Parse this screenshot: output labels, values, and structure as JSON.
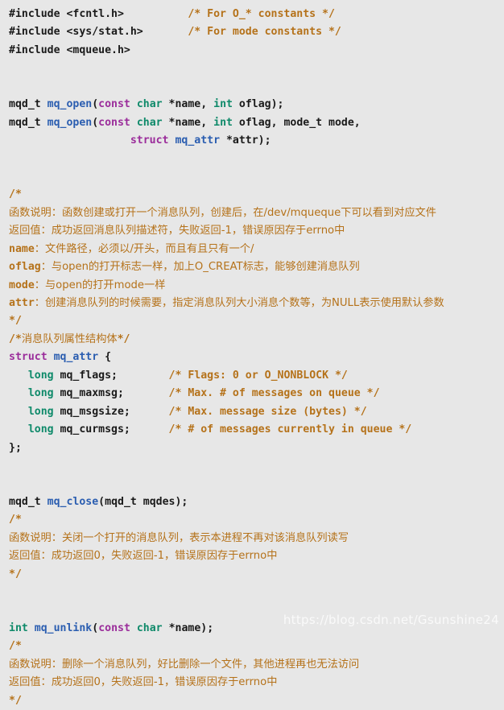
{
  "document": {
    "kind": "source-code-snippet",
    "language": "C",
    "background_color": "#e7e7e7",
    "colors": {
      "plain": "#1a1a1a",
      "comment": "#b5721a",
      "keyword": "#9b2d9b",
      "type": "#0f8a6a",
      "function": "#2a5db0",
      "watermark": "#ffffff"
    }
  },
  "watermark": {
    "text": "https://blog.csdn.net/Gsunshine24"
  },
  "lines": [
    {
      "n": 1,
      "tokens": [
        {
          "t": "plain",
          "v": "#include <fcntl.h>"
        },
        {
          "t": "plain",
          "v": "          "
        },
        {
          "t": "comment",
          "v": "/* For O_* constants */"
        }
      ]
    },
    {
      "n": 2,
      "tokens": [
        {
          "t": "plain",
          "v": "#include <sys/stat.h>"
        },
        {
          "t": "plain",
          "v": "       "
        },
        {
          "t": "comment",
          "v": "/* For mode constants */"
        }
      ]
    },
    {
      "n": 3,
      "tokens": [
        {
          "t": "plain",
          "v": "#include <mqueue.h>"
        }
      ]
    },
    {
      "n": 4,
      "tokens": []
    },
    {
      "n": 5,
      "tokens": []
    },
    {
      "n": 6,
      "tokens": [
        {
          "t": "plain",
          "v": "mqd_t "
        },
        {
          "t": "func",
          "v": "mq_open"
        },
        {
          "t": "punct",
          "v": "("
        },
        {
          "t": "keyword",
          "v": "const"
        },
        {
          "t": "plain",
          "v": " "
        },
        {
          "t": "type",
          "v": "char"
        },
        {
          "t": "plain",
          "v": " *name, "
        },
        {
          "t": "type",
          "v": "int"
        },
        {
          "t": "plain",
          "v": " oflag"
        },
        {
          "t": "punct",
          "v": ");"
        }
      ]
    },
    {
      "n": 7,
      "tokens": [
        {
          "t": "plain",
          "v": "mqd_t "
        },
        {
          "t": "func",
          "v": "mq_open"
        },
        {
          "t": "punct",
          "v": "("
        },
        {
          "t": "keyword",
          "v": "const"
        },
        {
          "t": "plain",
          "v": " "
        },
        {
          "t": "type",
          "v": "char"
        },
        {
          "t": "plain",
          "v": " *name, "
        },
        {
          "t": "type",
          "v": "int"
        },
        {
          "t": "plain",
          "v": " oflag, mode_t mode,"
        }
      ]
    },
    {
      "n": 8,
      "tokens": [
        {
          "t": "plain",
          "v": "                   "
        },
        {
          "t": "keyword",
          "v": "struct"
        },
        {
          "t": "plain",
          "v": " "
        },
        {
          "t": "func",
          "v": "mq_attr"
        },
        {
          "t": "plain",
          "v": " *attr"
        },
        {
          "t": "punct",
          "v": ");"
        }
      ]
    },
    {
      "n": 9,
      "tokens": []
    },
    {
      "n": 10,
      "tokens": []
    },
    {
      "n": 11,
      "tokens": [
        {
          "t": "comment",
          "v": "/*"
        }
      ]
    },
    {
      "n": 12,
      "tokens": [
        {
          "t": "cjk",
          "v": "函数说明："
        },
        {
          "t": "cjk",
          "v": "函数创建或打开一个消息队列，创建后，在/dev/mqueque下可以看到对应文件"
        }
      ]
    },
    {
      "n": 13,
      "tokens": [
        {
          "t": "cjk",
          "v": "返回值："
        },
        {
          "t": "cjk",
          "v": "成功返回消息队列描述符，失败返回-1，错误原因存于errno中"
        }
      ]
    },
    {
      "n": 14,
      "tokens": [
        {
          "t": "comment",
          "v": "name"
        },
        {
          "t": "cjk",
          "v": "："
        },
        {
          "t": "cjk",
          "v": "文件路径，必须以/开头，而且有且只有一个/"
        }
      ]
    },
    {
      "n": 15,
      "tokens": [
        {
          "t": "comment",
          "v": "oflag"
        },
        {
          "t": "cjk",
          "v": "："
        },
        {
          "t": "cjk",
          "v": "与open的打开标志一样，加上O_CREAT标志，能够创建消息队列"
        }
      ]
    },
    {
      "n": 16,
      "tokens": [
        {
          "t": "comment",
          "v": "mode"
        },
        {
          "t": "cjk",
          "v": "："
        },
        {
          "t": "cjk",
          "v": "与open的打开mode一样"
        }
      ]
    },
    {
      "n": 17,
      "tokens": [
        {
          "t": "comment",
          "v": "attr"
        },
        {
          "t": "cjk",
          "v": "："
        },
        {
          "t": "cjk",
          "v": "创建消息队列的时候需要，指定消息队列大小消息个数等，为NULL表示使用默认参数"
        }
      ]
    },
    {
      "n": 18,
      "tokens": [
        {
          "t": "comment",
          "v": "*/"
        }
      ]
    },
    {
      "n": 19,
      "tokens": [
        {
          "t": "comment",
          "v": "/*"
        },
        {
          "t": "cjk",
          "v": "消息队列属性结构体"
        },
        {
          "t": "comment",
          "v": "*/"
        }
      ]
    },
    {
      "n": 20,
      "tokens": [
        {
          "t": "keyword",
          "v": "struct"
        },
        {
          "t": "plain",
          "v": " "
        },
        {
          "t": "func",
          "v": "mq_attr"
        },
        {
          "t": "plain",
          "v": " "
        },
        {
          "t": "punct",
          "v": "{"
        }
      ]
    },
    {
      "n": 21,
      "tokens": [
        {
          "t": "plain",
          "v": "   "
        },
        {
          "t": "type",
          "v": "long"
        },
        {
          "t": "plain",
          "v": " mq_flags;"
        },
        {
          "t": "plain",
          "v": "        "
        },
        {
          "t": "comment",
          "v": "/* Flags: 0 or O_NONBLOCK */"
        }
      ]
    },
    {
      "n": 22,
      "tokens": [
        {
          "t": "plain",
          "v": "   "
        },
        {
          "t": "type",
          "v": "long"
        },
        {
          "t": "plain",
          "v": " mq_maxmsg;"
        },
        {
          "t": "plain",
          "v": "       "
        },
        {
          "t": "comment",
          "v": "/* Max. # of messages on queue */"
        }
      ]
    },
    {
      "n": 23,
      "tokens": [
        {
          "t": "plain",
          "v": "   "
        },
        {
          "t": "type",
          "v": "long"
        },
        {
          "t": "plain",
          "v": " mq_msgsize;"
        },
        {
          "t": "plain",
          "v": "      "
        },
        {
          "t": "comment",
          "v": "/* Max. message size (bytes) */"
        }
      ]
    },
    {
      "n": 24,
      "tokens": [
        {
          "t": "plain",
          "v": "   "
        },
        {
          "t": "type",
          "v": "long"
        },
        {
          "t": "plain",
          "v": " mq_curmsgs;"
        },
        {
          "t": "plain",
          "v": "      "
        },
        {
          "t": "comment",
          "v": "/* # of messages currently in queue */"
        }
      ]
    },
    {
      "n": 25,
      "tokens": [
        {
          "t": "punct",
          "v": "};"
        }
      ]
    },
    {
      "n": 26,
      "tokens": []
    },
    {
      "n": 27,
      "tokens": []
    },
    {
      "n": 28,
      "tokens": [
        {
          "t": "plain",
          "v": "mqd_t "
        },
        {
          "t": "func",
          "v": "mq_close"
        },
        {
          "t": "punct",
          "v": "("
        },
        {
          "t": "plain",
          "v": "mqd_t mqdes"
        },
        {
          "t": "punct",
          "v": ");"
        }
      ]
    },
    {
      "n": 29,
      "tokens": [
        {
          "t": "comment",
          "v": "/*"
        }
      ]
    },
    {
      "n": 30,
      "tokens": [
        {
          "t": "cjk",
          "v": "函数说明："
        },
        {
          "t": "cjk",
          "v": "关闭一个打开的消息队列，表示本进程不再对该消息队列读写"
        }
      ]
    },
    {
      "n": 31,
      "tokens": [
        {
          "t": "cjk",
          "v": "返回值："
        },
        {
          "t": "cjk",
          "v": "成功返回0，失败返回-1，错误原因存于errno中"
        }
      ]
    },
    {
      "n": 32,
      "tokens": [
        {
          "t": "comment",
          "v": "*/"
        }
      ]
    },
    {
      "n": 33,
      "tokens": []
    },
    {
      "n": 34,
      "tokens": []
    },
    {
      "n": 35,
      "tokens": [
        {
          "t": "type",
          "v": "int"
        },
        {
          "t": "plain",
          "v": " "
        },
        {
          "t": "func",
          "v": "mq_unlink"
        },
        {
          "t": "punct",
          "v": "("
        },
        {
          "t": "keyword",
          "v": "const"
        },
        {
          "t": "plain",
          "v": " "
        },
        {
          "t": "type",
          "v": "char"
        },
        {
          "t": "plain",
          "v": " *name"
        },
        {
          "t": "punct",
          "v": ");"
        }
      ]
    },
    {
      "n": 36,
      "tokens": [
        {
          "t": "comment",
          "v": "/*"
        }
      ]
    },
    {
      "n": 37,
      "tokens": [
        {
          "t": "cjk",
          "v": "函数说明："
        },
        {
          "t": "cjk",
          "v": "删除一个消息队列，好比删除一个文件，其他进程再也无法访问"
        }
      ]
    },
    {
      "n": 38,
      "tokens": [
        {
          "t": "cjk",
          "v": "返回值："
        },
        {
          "t": "cjk",
          "v": "成功返回0，失败返回-1，错误原因存于errno中"
        }
      ]
    },
    {
      "n": 39,
      "tokens": [
        {
          "t": "comment",
          "v": "*/"
        }
      ]
    }
  ]
}
